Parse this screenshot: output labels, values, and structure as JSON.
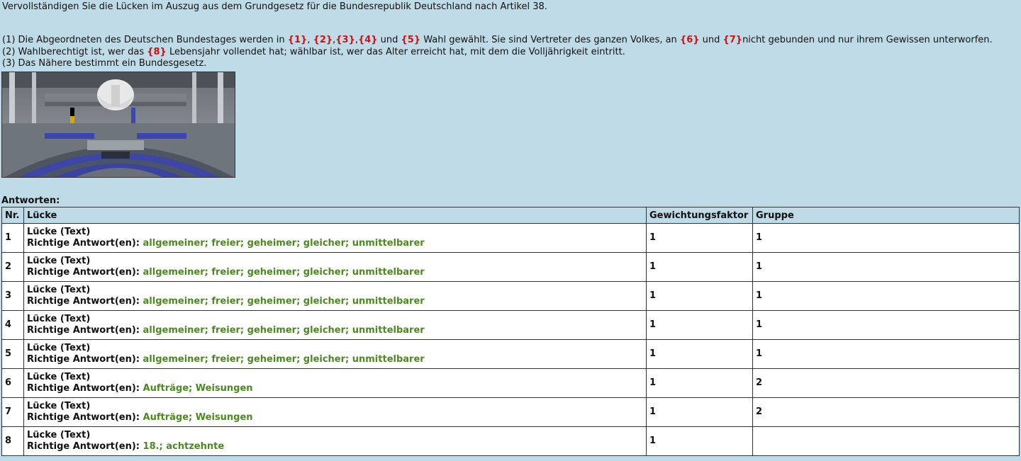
{
  "instruction": "Vervollständigen Sie die Lücken im Auszug aus dem Grundgesetz für die Bundesrepublik Deutschland nach Artikel 38.",
  "paragraph1": {
    "t1": "(1) Die Abgeordneten des Deutschen Bundestages werden in ",
    "g1": "{1}",
    "t2": ", ",
    "g2": "{2}",
    "t3": ",",
    "g3": "{3}",
    "t4": ",",
    "g4": "{4}",
    "t5": " und ",
    "g5": "{5}",
    "t6": " Wahl gewählt. Sie sind Vertreter des ganzen Volkes, an ",
    "g6": "{6}",
    "t7": " und ",
    "g7": "{7}",
    "t8": "nicht gebunden und nur ihrem Gewissen unterworfen."
  },
  "paragraph2": {
    "t1": "(2) Wahlberechtigt ist, wer das ",
    "g8": "{8}",
    "t2": " Lebensjahr vollendet hat; wählbar ist, wer das Alter erreicht hat, mit dem die Volljährigkeit eintritt."
  },
  "paragraph3": "(3) Das Nähere bestimmt ein Bundesgesetz.",
  "image_icon": "bundestag-plenary-photo",
  "answers_heading": "Antworten:",
  "table": {
    "headers": [
      "Nr.",
      "Lücke",
      "Gewichtungsfaktor",
      "Gruppe"
    ],
    "rows": [
      {
        "nr": "1",
        "type": "Lücke (Text)",
        "label": "Richtige Antwort(en):",
        "answer": "allgemeiner; freier; geheimer; gleicher; unmittelbarer",
        "weight": "1",
        "group": "1"
      },
      {
        "nr": "2",
        "type": "Lücke (Text)",
        "label": "Richtige Antwort(en):",
        "answer": "allgemeiner; freier; geheimer; gleicher; unmittelbarer",
        "weight": "1",
        "group": "1"
      },
      {
        "nr": "3",
        "type": "Lücke (Text)",
        "label": "Richtige Antwort(en):",
        "answer": "allgemeiner; freier; geheimer; gleicher; unmittelbarer",
        "weight": "1",
        "group": "1"
      },
      {
        "nr": "4",
        "type": "Lücke (Text)",
        "label": "Richtige Antwort(en):",
        "answer": "allgemeiner; freier; geheimer; gleicher; unmittelbarer",
        "weight": "1",
        "group": "1"
      },
      {
        "nr": "5",
        "type": "Lücke (Text)",
        "label": "Richtige Antwort(en):",
        "answer": "allgemeiner; freier; geheimer; gleicher; unmittelbarer",
        "weight": "1",
        "group": "1"
      },
      {
        "nr": "6",
        "type": "Lücke (Text)",
        "label": "Richtige Antwort(en):",
        "answer": "Aufträge; Weisungen",
        "weight": "1",
        "group": "2"
      },
      {
        "nr": "7",
        "type": "Lücke (Text)",
        "label": "Richtige Antwort(en):",
        "answer": "Aufträge; Weisungen",
        "weight": "1",
        "group": "2"
      },
      {
        "nr": "8",
        "type": "Lücke (Text)",
        "label": "Richtige Antwort(en):",
        "answer": "18.; achtzehnte",
        "weight": "1",
        "group": ""
      }
    ]
  },
  "colors": {
    "background": "#bfdbe7",
    "gap_red": "#d01010",
    "answer_green": "#4a8a1e"
  }
}
